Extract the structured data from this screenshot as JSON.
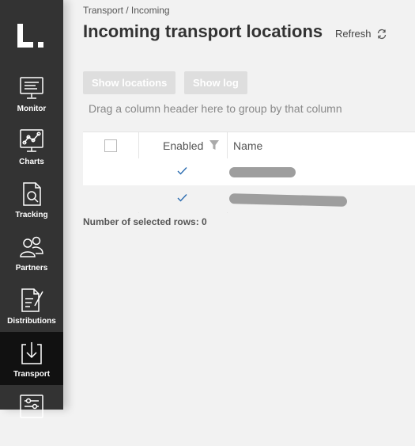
{
  "sidebar": {
    "logo_text": "L.",
    "items": [
      {
        "label": "Monitor",
        "icon": "monitor-icon"
      },
      {
        "label": "Charts",
        "icon": "charts-icon"
      },
      {
        "label": "Tracking",
        "icon": "tracking-icon"
      },
      {
        "label": "Partners",
        "icon": "partners-icon"
      },
      {
        "label": "Distributions",
        "icon": "distributions-icon"
      },
      {
        "label": "Transport",
        "icon": "transport-icon",
        "active": true
      },
      {
        "label": "",
        "icon": "settings-sliders-icon"
      }
    ]
  },
  "header": {
    "breadcrumb": "Transport / Incoming",
    "title": "Incoming transport locations",
    "refresh_label": "Refresh"
  },
  "toolbar": {
    "show_locations": "Show locations",
    "show_log": "Show log"
  },
  "grid": {
    "group_hint": "Drag a column header here to group by that column",
    "columns": [
      "Enabled",
      "Name"
    ],
    "rows": [
      {
        "enabled": true,
        "name": "[redacted]"
      },
      {
        "enabled": true,
        "name": "[redacted]"
      }
    ],
    "selected_rows_text": "Number of selected rows: 0"
  },
  "colors": {
    "sidebar_bg": "#333333",
    "sidebar_active": "#111111",
    "background": "#f2f2f2",
    "checkmark": "#2b6cb0"
  }
}
